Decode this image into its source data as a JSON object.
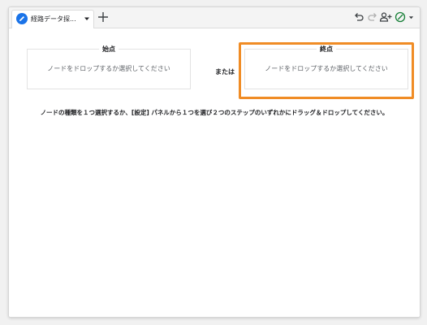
{
  "tab": {
    "label": "経路データ探..."
  },
  "colors": {
    "accent": "#1a73e8",
    "highlight": "#f08c25",
    "status_green": "#188038"
  },
  "start_node": {
    "title": "始点",
    "placeholder": "ノードをドロップするか選択してください"
  },
  "or_label": "または",
  "end_node": {
    "title": "終点",
    "placeholder": "ノードをドロップするか選択してください"
  },
  "instruction": "ノードの種類を１つ選択するか、[設定] パネルから１つを選び２つのステップのいずれかにドラッグ＆ドロップしてください。",
  "toolbar_icons": [
    "undo-icon",
    "redo-icon",
    "share-user-icon",
    "status-check-icon"
  ]
}
